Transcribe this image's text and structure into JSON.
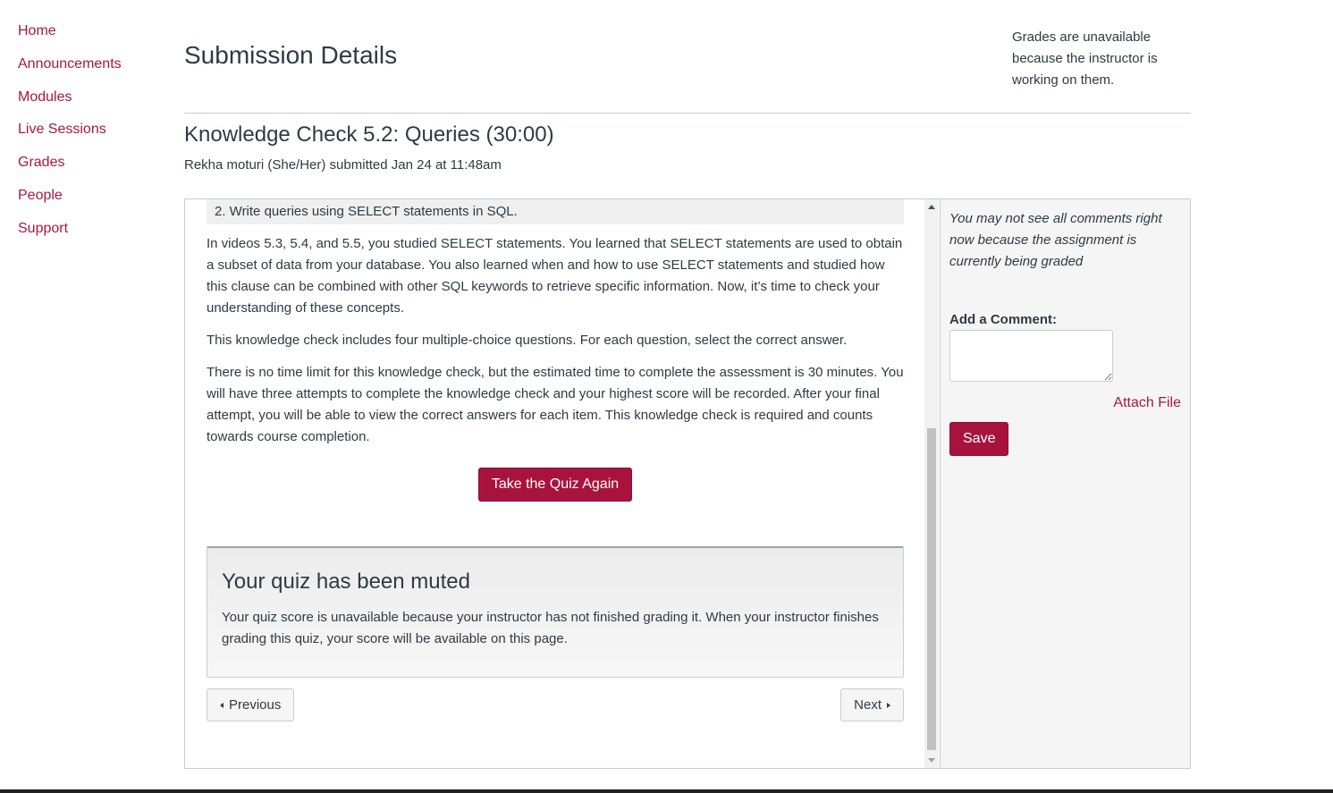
{
  "sidebar": {
    "items": [
      {
        "label": "Home"
      },
      {
        "label": "Announcements"
      },
      {
        "label": "Modules"
      },
      {
        "label": "Live Sessions"
      },
      {
        "label": "Grades"
      },
      {
        "label": "People"
      },
      {
        "label": "Support"
      }
    ]
  },
  "header": {
    "title": "Submission Details",
    "grades_note": "Grades are unavailable because the instructor is working on them."
  },
  "quiz": {
    "title": "Knowledge Check 5.2: Queries (30:00)",
    "submitted_by": "Rekha moturi (She/Her) submitted Jan 24 at 11:48am",
    "objective": "2. Write queries using SELECT statements in SQL.",
    "paragraphs": [
      "In videos 5.3, 5.4, and 5.5, you studied SELECT statements. You learned that SELECT statements are used to obtain a subset of data from your database. You also learned when and how to use SELECT statements and studied how this clause can be combined with other SQL keywords to retrieve specific information. Now, it’s time to check your understanding of these concepts.",
      "This knowledge check includes four multiple-choice questions. For each question, select the correct answer.",
      "There is no time limit for this knowledge check, but the estimated time to complete the assessment is 30 minutes. You will have three attempts to complete the knowledge check and your highest score will be recorded. After your final attempt, you will be able to view the correct answers for each item. This knowledge check is required and counts towards course completion."
    ],
    "retake_label": "Take the Quiz Again",
    "muted_title": "Your quiz has been muted",
    "muted_text": "Your quiz score is unavailable because your instructor has not finished grading it. When your instructor finishes grading this quiz, your score will be available on this page.",
    "previous_label": "Previous",
    "next_label": "Next"
  },
  "comments": {
    "note": "You may not see all comments right now because the assignment is currently being graded",
    "add_label": "Add a Comment:",
    "attach_label": "Attach File",
    "save_label": "Save"
  },
  "colors": {
    "accent": "#a8133e",
    "link": "#a8183e",
    "text": "#2d3b45"
  }
}
